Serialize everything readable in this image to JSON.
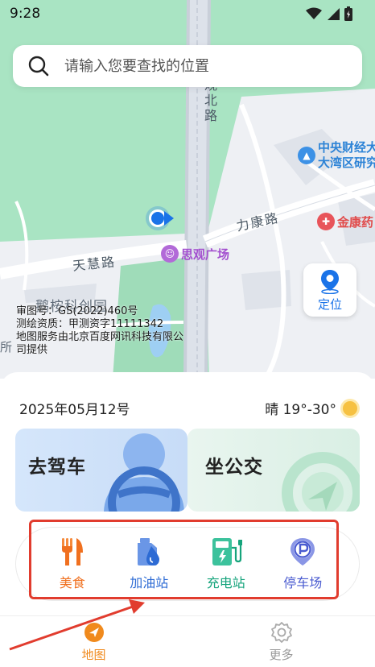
{
  "status_bar": {
    "time": "9:28"
  },
  "search": {
    "placeholder": "请输入您要查找的位置"
  },
  "map": {
    "roads": {
      "north": "观北路",
      "likang": "力康路",
      "tianhui": "天慧路"
    },
    "pois": {
      "siguan": "思观广场",
      "caijing": "中央财经大",
      "wanqu": "大湾区研究",
      "jinkang": "金康药"
    },
    "area": "鹅桉科创园",
    "area_left": "所",
    "info_lines": [
      "审图号：GS(2022)460号",
      "测绘资质：甲测资字11111342",
      "地图服务由北京百度网讯科技有限公",
      "司提供"
    ],
    "locate_label": "定位"
  },
  "sheet": {
    "date": "2025年05月12号",
    "weather": "晴 19°-30°",
    "cards": {
      "drive": "去驾车",
      "bus": "坐公交"
    },
    "services": [
      {
        "label": "美食",
        "icon": "fork-knife-icon"
      },
      {
        "label": "加油站",
        "icon": "fuel-drop-icon"
      },
      {
        "label": "充电站",
        "icon": "charging-station-icon"
      },
      {
        "label": "停车场",
        "icon": "parking-pin-icon"
      }
    ]
  },
  "nav": [
    {
      "label": "地图",
      "icon": "compass-icon"
    },
    {
      "label": "更多",
      "icon": "gear-icon"
    }
  ],
  "colors": {
    "accent_orange": "#f08a1d",
    "primary_blue": "#1a73e8",
    "map_green": "#a9e4c3",
    "annotation_red": "#e13c2e"
  }
}
